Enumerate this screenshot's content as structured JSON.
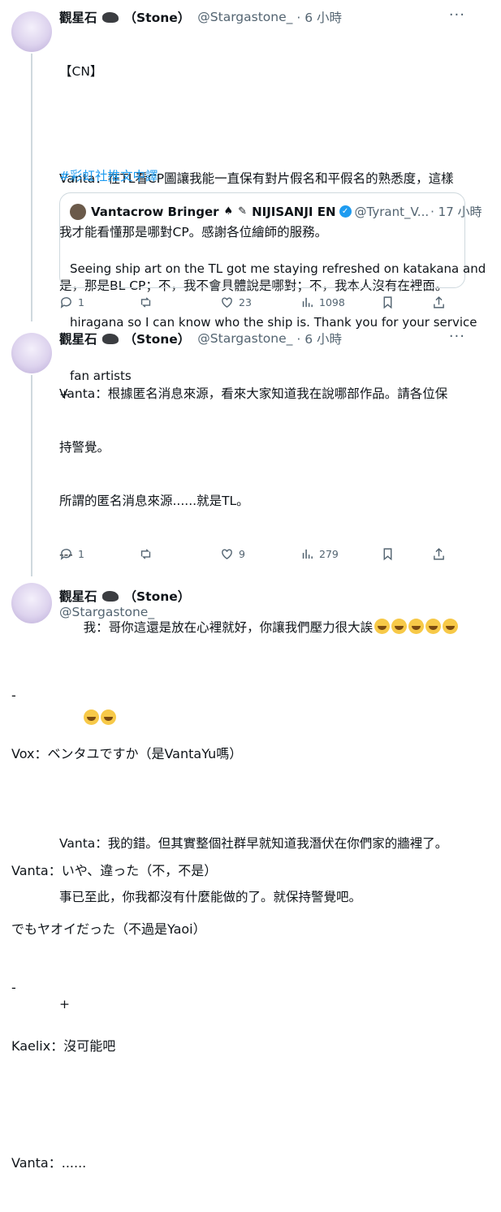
{
  "tweets": [
    {
      "name": "觀星石",
      "name_suffix": "（Stone）",
      "handle": "@Stargastone_",
      "time": "· 6 小時",
      "lines": [
        "【CN】",
        "",
        "Vanta：在TL看CP圖讓我能一直保有對片假名和平假名的熟悉度，這樣",
        "我才能看懂那是哪對CP。感謝各位繪師的服務。",
        "是，那是BL CP；不，我不會具體說是哪對；不，我本人沒有在裡面。",
        "",
        "+"
      ],
      "hashtag": "#彩虹社推文中譯",
      "quote": {
        "name": "Vantacrow Bringer",
        "org": "NIJISANJI EN",
        "handle": "@Tyrant_V...",
        "time": "· 17 小時",
        "lines": [
          "Seeing ship art on the TL got me staying refreshed on katakana and",
          "hiragana so I can know who the ship is. Thank you for your service",
          "fan artists"
        ]
      },
      "actions": {
        "reply": "1",
        "retweet": "",
        "like": "23",
        "views": "1098"
      }
    },
    {
      "name": "觀星石",
      "name_suffix": "（Stone）",
      "handle": "@Stargastone_",
      "time": "· 6 小時",
      "lines": [
        "Vanta：根據匿名消息來源，看來大家知道我在說哪部作品。請各位保",
        "持警覺。",
        "所謂的匿名消息來源......就是TL。",
        "---"
      ],
      "line_emoji": "我：哥你這還是放在心裡就好，你讓我們壓力很大誒",
      "lines_after": [
        "",
        "Vanta：我的錯。但其實整個社群早就知道我潛伏在你們家的牆裡了。",
        "事已至此，你我都沒有什麼能做的了。就保持警覺吧。",
        "",
        "+"
      ],
      "actions": {
        "reply": "1",
        "retweet": "",
        "like": "9",
        "views": "279"
      }
    },
    {
      "name": "觀星石",
      "name_suffix": "（Stone）",
      "handle": "@Stargastone_",
      "lines": [
        "-",
        "Vox：ベンタユですか（是VantaYu嗎）",
        "",
        "Vanta：いや、違った（不，不是）",
        "でもヤオイだった（不過是Yaoi）",
        "-",
        "Kaelix：沒可能吧",
        "",
        "Vanta：......"
      ]
    }
  ],
  "icons": [
    "reply-icon",
    "retweet-icon",
    "like-icon",
    "views-icon",
    "bookmark-icon",
    "share-icon",
    "more-icon",
    "verified-icon"
  ],
  "colors": {
    "accent": "#1d9bf0",
    "muted": "#536471",
    "border": "#cfd9de"
  }
}
